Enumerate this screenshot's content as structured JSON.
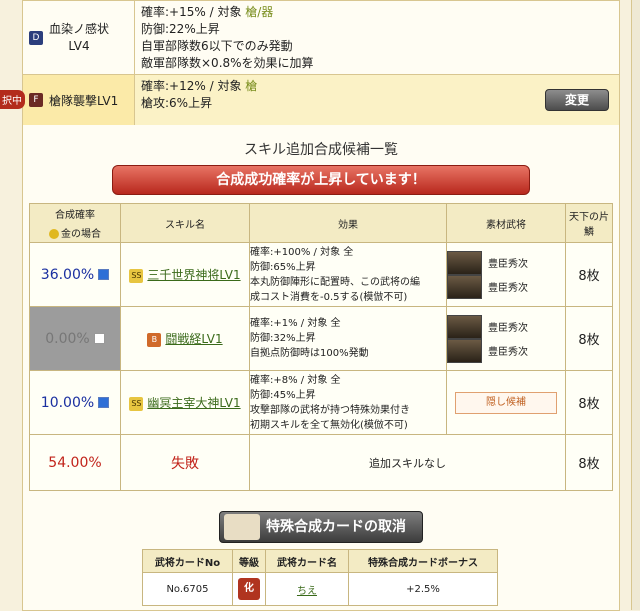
{
  "top_skills": [
    {
      "grade": "D",
      "name": "血染ノ感状",
      "level": "LV4",
      "lines": [
        "確率:+15%  /  対象 槍/器",
        "防御:22%上昇",
        "自軍部隊数6以下でのみ発動",
        "敵軍部隊数×0.8%を効果に加算"
      ],
      "target": "槍/器"
    },
    {
      "grade": "F",
      "name": "槍隊襲撃LV1",
      "lines": [
        "確率:+12%  /  対象 槍",
        "槍攻:6%上昇"
      ],
      "target": "槍",
      "button": "変更"
    }
  ],
  "selected_tab": "択中",
  "panel": {
    "title": "スキル追加合成候補一覧",
    "banner": "合成成功確率が上昇しています！",
    "headers": {
      "rate": "合成確率",
      "gold": "金の場合",
      "skill": "スキル名",
      "effect": "効果",
      "material": "素材武将",
      "count": "天下の片鱗"
    },
    "rows": [
      {
        "rate": "36.00%",
        "checked": true,
        "grade": "SS",
        "skill": "三千世界神将LV1",
        "effects": [
          "確率:+100%  /  対象  全",
          "防御:65%上昇",
          "本丸防御陣形に配置時、この武将の編",
          "成コスト消費を-0.5する(模倣不可)"
        ],
        "materials": [
          "豊臣秀次",
          "豊臣秀次"
        ],
        "count": "8枚"
      },
      {
        "rate": "0.00%",
        "checked": false,
        "grade": "B",
        "skill": "闘戦経LV1",
        "effects": [
          "確率:+1%  /  対象  全",
          "防御:32%上昇",
          "自拠点防御時は100%発動"
        ],
        "materials": [
          "豊臣秀次",
          "豊臣秀次"
        ],
        "count": "8枚"
      },
      {
        "rate": "10.00%",
        "checked": true,
        "grade": "SS",
        "skill": "幽冥主宰大神LV1",
        "effects": [
          "確率:+8%  /  対象  全",
          "防御:45%上昇",
          "攻撃部隊の武将が持つ特殊効果付き",
          "初期スキルを全て無効化(模倣不可)"
        ],
        "materials_button": "隠し候補",
        "count": "8枚"
      },
      {
        "rate": "54.00%",
        "fail": "失敗",
        "effect_text": "追加スキルなし",
        "count": "8枚"
      }
    ],
    "cancel_button": "特殊合成カードの取消",
    "card_table": {
      "headers": [
        "武将カードNo",
        "等級",
        "武将カード名",
        "特殊合成カードボーナス"
      ],
      "row": {
        "no": "No.6705",
        "grade": "化",
        "name": "ちえ",
        "bonus": "+2.5%"
      }
    }
  },
  "colors": {
    "accent": "#b32b1c",
    "target_green": "#7a8e1e",
    "rate_blue": "#1a2fa0"
  }
}
